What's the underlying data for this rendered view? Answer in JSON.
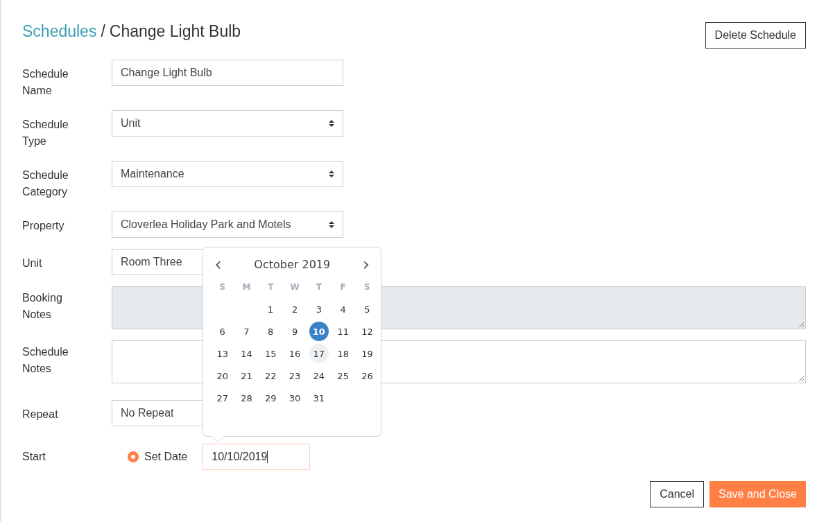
{
  "breadcrumb": {
    "link": "Schedules",
    "separator": "/",
    "current": "Change Light Bulb"
  },
  "delete_button": "Delete Schedule",
  "fields": [
    {
      "label": "Schedule Name",
      "kind": "text",
      "value": "Change Light Bulb"
    },
    {
      "label": "Schedule Type",
      "kind": "select",
      "value": "Unit"
    },
    {
      "label": "Schedule Category",
      "kind": "select",
      "value": "Maintenance"
    },
    {
      "label": "Property",
      "kind": "select",
      "value": "Cloverlea Holiday Park and Motels"
    },
    {
      "label": "Unit",
      "kind": "select",
      "value": "Room Three"
    },
    {
      "label": "Booking Notes",
      "kind": "textarea",
      "disabled": true
    },
    {
      "label": "Schedule Notes",
      "kind": "textarea",
      "disabled": false
    },
    {
      "label": "Repeat",
      "kind": "select",
      "value": "No Repeat"
    }
  ],
  "start": {
    "label": "Start",
    "option": {
      "label": "Set Date",
      "selected": true
    },
    "date_value": "10/10/2019"
  },
  "calendar": {
    "prev": "‹",
    "next": "›",
    "month": "October 2019",
    "weekdays": [
      "S",
      "M",
      "T",
      "W",
      "T",
      "F",
      "S"
    ],
    "weeks": [
      [
        {
          "kind": "empty"
        },
        {
          "kind": "empty"
        },
        {
          "day": "1",
          "selected": false,
          "hovered": false
        },
        {
          "day": "2",
          "selected": false,
          "hovered": false
        },
        {
          "day": "3",
          "selected": false,
          "hovered": false
        },
        {
          "day": "4",
          "selected": false,
          "hovered": false
        },
        {
          "day": "5",
          "selected": false,
          "hovered": false
        }
      ],
      [
        {
          "day": "6",
          "selected": false,
          "hovered": false
        },
        {
          "day": "7",
          "selected": false,
          "hovered": false
        },
        {
          "day": "8",
          "selected": false,
          "hovered": false
        },
        {
          "day": "9",
          "selected": false,
          "hovered": false
        },
        {
          "day": "10",
          "selected": true,
          "hovered": false
        },
        {
          "day": "11",
          "selected": false,
          "hovered": false
        },
        {
          "day": "12",
          "selected": false,
          "hovered": false
        }
      ],
      [
        {
          "day": "13",
          "selected": false,
          "hovered": false
        },
        {
          "day": "14",
          "selected": false,
          "hovered": false
        },
        {
          "day": "15",
          "selected": false,
          "hovered": false
        },
        {
          "day": "16",
          "selected": false,
          "hovered": false
        },
        {
          "day": "17",
          "selected": false,
          "hovered": true
        },
        {
          "day": "18",
          "selected": false,
          "hovered": false
        },
        {
          "day": "19",
          "selected": false,
          "hovered": false
        }
      ],
      [
        {
          "day": "20",
          "selected": false,
          "hovered": false
        },
        {
          "day": "21",
          "selected": false,
          "hovered": false
        },
        {
          "day": "22",
          "selected": false,
          "hovered": false
        },
        {
          "day": "23",
          "selected": false,
          "hovered": false
        },
        {
          "day": "24",
          "selected": false,
          "hovered": false
        },
        {
          "day": "25",
          "selected": false,
          "hovered": false
        },
        {
          "day": "26",
          "selected": false,
          "hovered": false
        }
      ],
      [
        {
          "day": "27",
          "selected": false,
          "hovered": false
        },
        {
          "day": "28",
          "selected": false,
          "hovered": false
        },
        {
          "day": "29",
          "selected": false,
          "hovered": false
        },
        {
          "day": "30",
          "selected": false,
          "hovered": false
        },
        {
          "day": "31",
          "selected": false,
          "hovered": false
        }
      ]
    ]
  },
  "buttons": [
    {
      "label": "Cancel",
      "kind": "secondary"
    },
    {
      "label": "Save and Close",
      "kind": "primary"
    }
  ]
}
